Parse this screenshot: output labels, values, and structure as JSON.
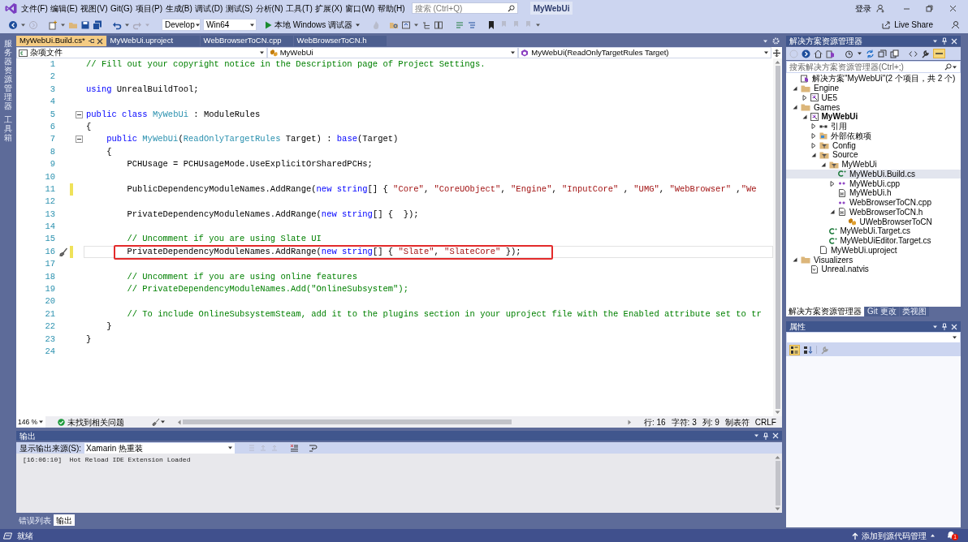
{
  "title_bar": {
    "menus": [
      "文件(F)",
      "编辑(E)",
      "视图(V)",
      "Git(G)",
      "项目(P)",
      "生成(B)",
      "调试(D)",
      "测试(S)",
      "分析(N)",
      "工具(T)",
      "扩展(X)",
      "窗口(W)",
      "帮助(H)"
    ],
    "search_placeholder": "搜索 (Ctrl+Q)",
    "solution_name": "MyWebUi",
    "sign_in": "登录"
  },
  "toolbar": {
    "configuration": "Develop",
    "platform": "Win64",
    "debugger": "本地 Windows 调试器",
    "live_share": "Live Share"
  },
  "side_tabs": [
    "服务器资源管理器",
    "工具箱"
  ],
  "editor": {
    "tabs": [
      {
        "label": "MyWebUi.Build.cs*",
        "selected": true
      },
      {
        "label": "MyWebUi.uproject",
        "selected": false
      },
      {
        "label": "WebBrowserToCN.cpp",
        "selected": false
      },
      {
        "label": "WebBrowserToCN.h",
        "selected": false
      }
    ],
    "navigation": [
      "杂项文件",
      "MyWebUi",
      "MyWebUi(ReadOnlyTargetRules Target)"
    ],
    "lines": [
      {
        "number": "1",
        "changed": false,
        "current": false,
        "foldable": false,
        "boxed": false,
        "tokens": [
          {
            "kind": "comment",
            "text": "// Fill out your copyright notice in the Description page of Project Settings."
          }
        ]
      },
      {
        "number": "2",
        "changed": false,
        "current": false,
        "foldable": false,
        "boxed": false
      },
      {
        "number": "3",
        "changed": false,
        "current": false,
        "foldable": false,
        "boxed": false,
        "tokens": [
          {
            "kind": "keyword",
            "text": "using"
          },
          {
            "kind": "plain",
            "text": " UnrealBuildTool;"
          }
        ]
      },
      {
        "number": "4",
        "changed": false,
        "current": false,
        "foldable": false,
        "boxed": false
      },
      {
        "number": "5",
        "changed": false,
        "current": false,
        "foldable": true,
        "boxed": false,
        "tokens": [
          {
            "kind": "keyword",
            "text": "public class "
          },
          {
            "kind": "type",
            "text": "MyWebUi"
          },
          {
            "kind": "plain",
            "text": " : ModuleRules"
          }
        ]
      },
      {
        "number": "6",
        "changed": false,
        "current": false,
        "foldable": false,
        "boxed": false,
        "tokens": [
          {
            "kind": "plain",
            "text": "{"
          }
        ]
      },
      {
        "number": "7",
        "changed": false,
        "current": false,
        "foldable": true,
        "boxed": false,
        "tokens": [
          {
            "kind": "keyword",
            "text": "    public "
          },
          {
            "kind": "type",
            "text": "MyWebUi"
          },
          {
            "kind": "plain",
            "text": "("
          },
          {
            "kind": "type",
            "text": "ReadOnlyTargetRules"
          },
          {
            "kind": "plain",
            "text": " Target) : "
          },
          {
            "kind": "keyword",
            "text": "base"
          },
          {
            "kind": "plain",
            "text": "(Target)"
          }
        ]
      },
      {
        "number": "8",
        "changed": false,
        "current": false,
        "foldable": false,
        "boxed": false,
        "tokens": [
          {
            "kind": "plain",
            "text": "    {"
          }
        ]
      },
      {
        "number": "9",
        "changed": false,
        "current": false,
        "foldable": false,
        "boxed": false,
        "tokens": [
          {
            "kind": "plain",
            "text": "        PCHUsage = PCHUsageMode.UseExplicitOrSharedPCHs;"
          }
        ]
      },
      {
        "number": "10",
        "changed": false,
        "current": false,
        "foldable": false,
        "boxed": false
      },
      {
        "number": "11",
        "changed": true,
        "current": false,
        "foldable": false,
        "boxed": false,
        "tokens": [
          {
            "kind": "plain",
            "text": "        PublicDependencyModuleNames.AddRange("
          },
          {
            "kind": "keyword",
            "text": "new string"
          },
          {
            "kind": "plain",
            "text": "[] { "
          },
          {
            "kind": "string",
            "text": "\"Core\""
          },
          {
            "kind": "plain",
            "text": ", "
          },
          {
            "kind": "string",
            "text": "\"CoreUObject\""
          },
          {
            "kind": "plain",
            "text": ", "
          },
          {
            "kind": "string",
            "text": "\"Engine\""
          },
          {
            "kind": "plain",
            "text": ", "
          },
          {
            "kind": "string",
            "text": "\"InputCore\""
          },
          {
            "kind": "plain",
            "text": " , "
          },
          {
            "kind": "string",
            "text": "\"UMG\""
          },
          {
            "kind": "plain",
            "text": ", "
          },
          {
            "kind": "string",
            "text": "\"WebBrowser\""
          },
          {
            "kind": "plain",
            "text": " ,"
          },
          {
            "kind": "string",
            "text": "\"We"
          }
        ]
      },
      {
        "number": "12",
        "changed": false,
        "current": false,
        "foldable": false,
        "boxed": false
      },
      {
        "number": "13",
        "changed": false,
        "current": false,
        "foldable": false,
        "boxed": false,
        "tokens": [
          {
            "kind": "plain",
            "text": "        PrivateDependencyModuleNames.AddRange("
          },
          {
            "kind": "keyword",
            "text": "new string"
          },
          {
            "kind": "plain",
            "text": "[] {  });"
          }
        ]
      },
      {
        "number": "14",
        "changed": false,
        "current": false,
        "foldable": false,
        "boxed": false
      },
      {
        "number": "15",
        "changed": false,
        "current": false,
        "foldable": false,
        "boxed": false,
        "tokens": [
          {
            "kind": "comment",
            "text": "        // Uncomment if you are using Slate UI"
          }
        ]
      },
      {
        "number": "16",
        "changed": true,
        "current": true,
        "foldable": false,
        "boxed": true,
        "tokens": [
          {
            "kind": "plain",
            "text": "        PrivateDependencyModuleNames.AddRange("
          },
          {
            "kind": "keyword",
            "text": "new string"
          },
          {
            "kind": "plain",
            "text": "[] { "
          },
          {
            "kind": "string",
            "text": "\"Slate\""
          },
          {
            "kind": "plain",
            "text": ", "
          },
          {
            "kind": "string",
            "text": "\"SlateCore\""
          },
          {
            "kind": "plain",
            "text": " });"
          }
        ]
      },
      {
        "number": "17",
        "changed": false,
        "current": false,
        "foldable": false,
        "boxed": false
      },
      {
        "number": "18",
        "changed": false,
        "current": false,
        "foldable": false,
        "boxed": false,
        "tokens": [
          {
            "kind": "comment",
            "text": "        // Uncomment if you are using online features"
          }
        ]
      },
      {
        "number": "19",
        "changed": false,
        "current": false,
        "foldable": false,
        "boxed": false,
        "tokens": [
          {
            "kind": "comment",
            "text": "        // PrivateDependencyModuleNames.Add(\"OnlineSubsystem\");"
          }
        ]
      },
      {
        "number": "20",
        "changed": false,
        "current": false,
        "foldable": false,
        "boxed": false
      },
      {
        "number": "21",
        "changed": false,
        "current": false,
        "foldable": false,
        "boxed": false,
        "tokens": [
          {
            "kind": "comment",
            "text": "        // To include OnlineSubsystemSteam, add it to the plugins section in your uproject file with the Enabled attribute set to tr"
          }
        ]
      },
      {
        "number": "22",
        "changed": false,
        "current": false,
        "foldable": false,
        "boxed": false,
        "tokens": [
          {
            "kind": "plain",
            "text": "    }"
          }
        ]
      },
      {
        "number": "23",
        "changed": false,
        "current": false,
        "foldable": false,
        "boxed": false,
        "tokens": [
          {
            "kind": "plain",
            "text": "}"
          }
        ]
      },
      {
        "number": "24",
        "changed": false,
        "current": false,
        "foldable": false,
        "boxed": false
      }
    ],
    "status": {
      "zoom": "146 %",
      "issues": "未找到相关问题",
      "line": "行: 16",
      "character": "字符: 3",
      "column": "列: 9",
      "indentation": "制表符",
      "line_ending": "CRLF"
    }
  },
  "output": {
    "title": "输出",
    "source_label": "显示输出来源(S):",
    "source": "Xamarin 热重装",
    "lines": [
      "[16:06:10]  Hot Reload IDE Extension Loaded"
    ]
  },
  "bottom_tabs": [
    {
      "label": "错误列表",
      "selected": false
    },
    {
      "label": "输出",
      "selected": true
    }
  ],
  "solution_explorer": {
    "title": "解决方案资源管理器",
    "search_placeholder": "搜索解决方案资源管理器(Ctrl+;)",
    "tree": [
      {
        "label": "解决方案\"MyWebUi\"(2 个项目，共 2 个)",
        "kind": "solution",
        "selected": false,
        "children": [
          {
            "label": "Engine",
            "kind": "folder",
            "expanded": true,
            "selected": false,
            "children": [
              {
                "label": "UE5",
                "kind": "project",
                "startup": false,
                "expanded": false,
                "selected": false
              }
            ]
          },
          {
            "label": "Games",
            "kind": "folder",
            "expanded": true,
            "selected": false,
            "children": [
              {
                "label": "MyWebUi",
                "kind": "project",
                "startup": true,
                "expanded": true,
                "selected": false,
                "children": [
                  {
                    "label": "引用",
                    "kind": "references",
                    "expanded": false,
                    "selected": false
                  },
                  {
                    "label": "外部依赖项",
                    "kind": "dependencies",
                    "expanded": false,
                    "selected": false
                  },
                  {
                    "label": "Config",
                    "kind": "filter",
                    "expanded": false,
                    "selected": false
                  },
                  {
                    "label": "Source",
                    "kind": "filter",
                    "expanded": true,
                    "selected": false,
                    "children": [
                      {
                        "label": "MyWebUi",
                        "kind": "filter",
                        "expanded": true,
                        "selected": false,
                        "children": [
                          {
                            "label": "MyWebUi.Build.cs",
                            "kind": "csharp",
                            "selected": true
                          },
                          {
                            "label": "MyWebUi.cpp",
                            "kind": "cpp",
                            "expanded": false,
                            "selected": false
                          },
                          {
                            "label": "MyWebUi.h",
                            "kind": "header",
                            "selected": false
                          },
                          {
                            "label": "WebBrowserToCN.cpp",
                            "kind": "cpp",
                            "selected": false
                          },
                          {
                            "label": "WebBrowserToCN.h",
                            "kind": "header",
                            "expanded": true,
                            "selected": false,
                            "children": [
                              {
                                "label": "UWebBrowserToCN",
                                "kind": "class",
                                "selected": false
                              }
                            ]
                          }
                        ]
                      },
                      {
                        "label": "MyWebUi.Target.cs",
                        "kind": "csharp",
                        "selected": false
                      },
                      {
                        "label": "MyWebUiEditor.Target.cs",
                        "kind": "csharp",
                        "selected": false
                      }
                    ]
                  },
                  {
                    "label": "MyWebUi.uproject",
                    "kind": "file",
                    "selected": false
                  }
                ]
              }
            ]
          },
          {
            "label": "Visualizers",
            "kind": "folder",
            "expanded": true,
            "selected": false,
            "children": [
              {
                "label": "Unreal.natvis",
                "kind": "natvis",
                "selected": false
              }
            ]
          }
        ]
      }
    ],
    "tabs": [
      {
        "label": "解决方案资源管理器",
        "selected": true
      },
      {
        "label": "Git 更改",
        "selected": false
      },
      {
        "label": "类视图",
        "selected": false
      }
    ]
  },
  "properties": {
    "title": "属性"
  },
  "status_bar": {
    "message": "就绪",
    "source_control": "添加到源代码管理",
    "notifications": "1"
  }
}
